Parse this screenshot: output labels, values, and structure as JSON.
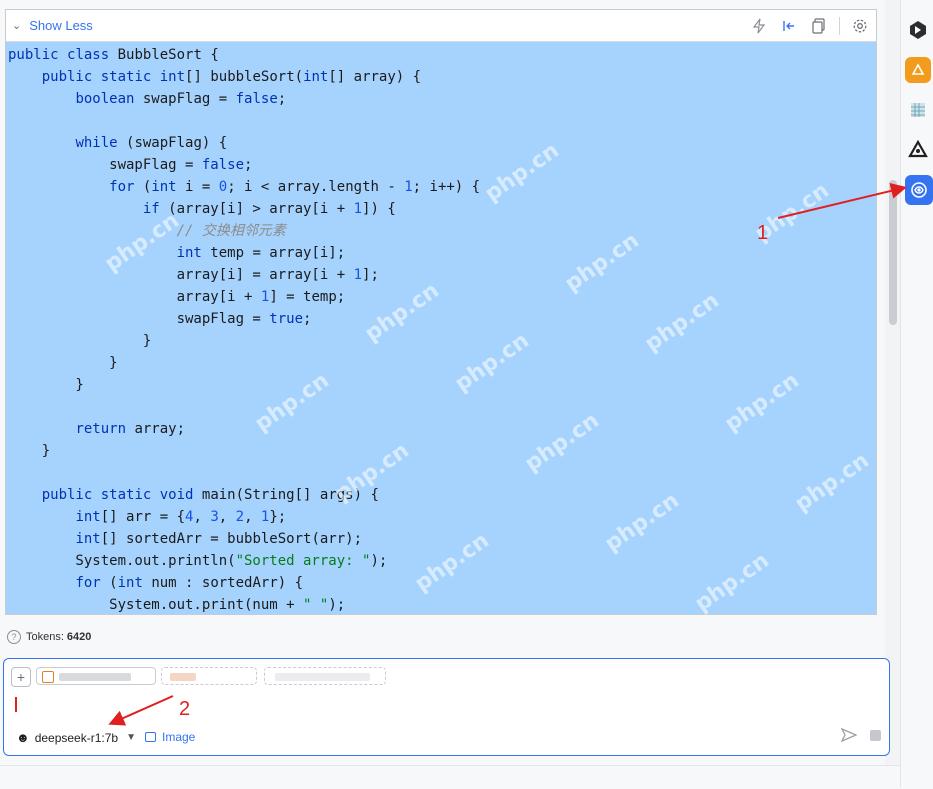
{
  "panel": {
    "show_less_label": "Show Less",
    "header_icons": [
      "bolt-icon",
      "collapse-left-icon",
      "copy-icon",
      "settings-icon"
    ]
  },
  "code_lines": [
    "public class BubbleSort {",
    "    public static int[] bubbleSort(int[] array) {",
    "        boolean swapFlag = false;",
    "",
    "        while (swapFlag) {",
    "            swapFlag = false;",
    "            for (int i = 0; i < array.length - 1; i++) {",
    "                if (array[i] > array[i + 1]) {",
    "                    // 交换相邻元素",
    "                    int temp = array[i];",
    "                    array[i] = array[i + 1];",
    "                    array[i + 1] = temp;",
    "                    swapFlag = true;",
    "                }",
    "            }",
    "        }",
    "",
    "        return array;",
    "    }",
    "",
    "    public static void main(String[] args) {",
    "        int[] arr = {4, 3, 2, 1};",
    "        int[] sortedArr = bubbleSort(arr);",
    "        System.out.println(\"Sorted array: \");",
    "        for (int num : sortedArr) {",
    "            System.out.print(num + \" \");"
  ],
  "watermark_text": "php.cn",
  "tokens": {
    "label": "Tokens:",
    "value": "6420"
  },
  "input": {
    "model_name": "deepseek-r1:7b",
    "image_label": "Image"
  },
  "annotations": {
    "one": "1",
    "two": "2"
  },
  "colors": {
    "accent": "#3574f0",
    "code_selection": "#a6d2fe",
    "annotation_red": "#e02020"
  }
}
